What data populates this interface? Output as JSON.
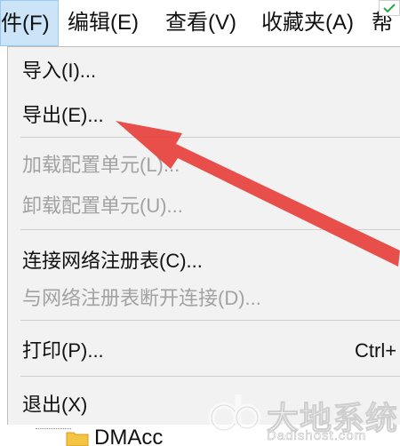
{
  "menubar": {
    "file": "件(F)",
    "edit": "编辑(E)",
    "view": "查看(V)",
    "favorites": "收藏夹(A)",
    "help": "帮"
  },
  "file_menu": {
    "items": [
      {
        "label": "导入(I)...",
        "enabled": true
      },
      {
        "label": "导出(E)...",
        "enabled": true
      },
      {
        "label": "加载配置单元(L)...",
        "enabled": false
      },
      {
        "label": "卸载配置单元(U)...",
        "enabled": false
      },
      {
        "label": "连接网络注册表(C)...",
        "enabled": true
      },
      {
        "label": "与网络注册表断开连接(D)...",
        "enabled": false
      },
      {
        "label": "打印(P)...",
        "enabled": true,
        "shortcut": "Ctrl+"
      },
      {
        "label": "退出(X)",
        "enabled": true
      }
    ]
  },
  "tree": {
    "folder_label": "DMAcc"
  },
  "watermark": {
    "title": "大地系统",
    "url": "Dadishost.com"
  },
  "colors": {
    "menu_highlight": "#cce4f7",
    "menu_bg": "#f2f2f2",
    "disabled_text": "#a2a2a2",
    "arrow": "#e8413c"
  },
  "icons": {
    "folder": "folder-icon",
    "arrow": "red-arrow-annotation",
    "badge": "check-badge-icon"
  }
}
